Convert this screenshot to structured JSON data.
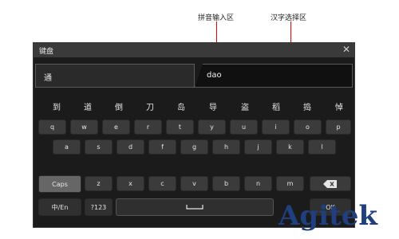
{
  "annotations": {
    "pinyin_area": "拼音输入区",
    "char_select_area": "汉字选择区"
  },
  "window": {
    "title": "键盘",
    "close_icon": "close-icon"
  },
  "input": {
    "selected_char": "通",
    "pinyin": "dao"
  },
  "candidates": [
    "到",
    "道",
    "倒",
    "刀",
    "岛",
    "导",
    "盗",
    "稻",
    "捣",
    "悼"
  ],
  "keyboard": {
    "row1": [
      "q",
      "w",
      "e",
      "r",
      "t",
      "y",
      "u",
      "i",
      "o",
      "p"
    ],
    "row2": [
      "a",
      "s",
      "d",
      "f",
      "g",
      "h",
      "j",
      "k",
      "l"
    ],
    "row3": [
      "Caps",
      "z",
      "x",
      "c",
      "v",
      "b",
      "n",
      "m"
    ],
    "row4": {
      "lang": "中/En",
      "symbols": "?123",
      "ok": "OK"
    },
    "icons": {
      "backspace": "backspace-icon",
      "space": "space-icon"
    }
  },
  "watermark": "Agitek",
  "colors": {
    "arrow": "#e00000",
    "caps_active": "#666666",
    "logo": "#1f3f7f"
  }
}
